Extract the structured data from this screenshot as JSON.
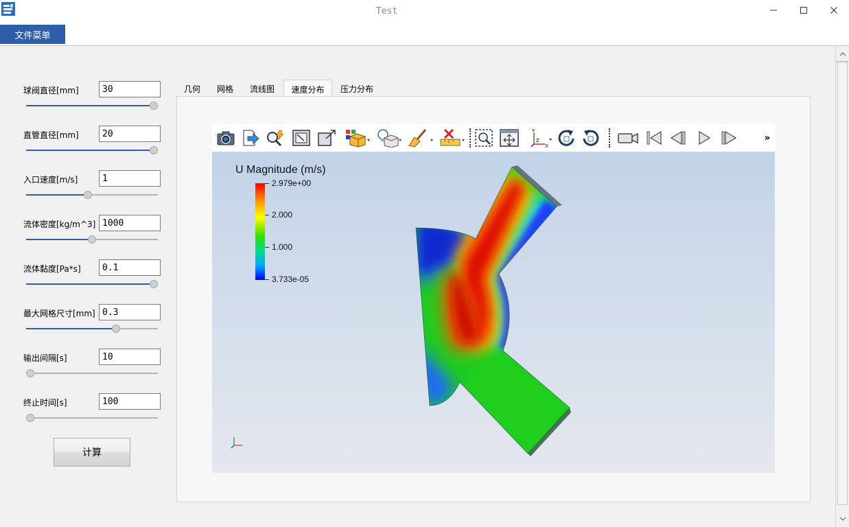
{
  "window": {
    "title": "Test"
  },
  "menu": {
    "file_label": "文件菜单"
  },
  "params": [
    {
      "label": "球阀直径[mm]",
      "value": "30",
      "slider_fraction": 1.0
    },
    {
      "label": "直管直径[mm]",
      "value": "20",
      "slider_fraction": 1.0
    },
    {
      "label": "入口速度[m/s]",
      "value": "1",
      "slider_fraction": 0.47
    },
    {
      "label": "流体密度[kg/m^3]",
      "value": "1000",
      "slider_fraction": 0.5
    },
    {
      "label": "流体黏度[Pa*s]",
      "value": "0.1",
      "slider_fraction": 1.0
    },
    {
      "label": "最大网格尺寸[mm]",
      "value": "0.3",
      "slider_fraction": 0.68
    },
    {
      "label": "输出间隔[s]",
      "value": "10",
      "slider_fraction": 0.0
    },
    {
      "label": "终止时间[s]",
      "value": "100",
      "slider_fraction": 0.0
    }
  ],
  "calc_button": "计算",
  "tabs": [
    {
      "label": "几何",
      "active": false
    },
    {
      "label": "网格",
      "active": false
    },
    {
      "label": "流线图",
      "active": false
    },
    {
      "label": "速度分布",
      "active": true
    },
    {
      "label": "压力分布",
      "active": false
    }
  ],
  "toolbar": {
    "icons": [
      "camera-icon",
      "export-icon",
      "query-icon",
      "reset-view-icon",
      "zoom-to-data-icon",
      "color-blocks-icon",
      "lighting-icon",
      "clean-icon",
      "ruler-icon",
      "zoom-box-icon",
      "fit-view-icon",
      "axes-orient-icon",
      "rotate-cw-icon",
      "rotate-ccw-icon",
      "record-icon",
      "first-frame-icon",
      "prev-frame-icon",
      "play-icon",
      "next-frame-icon"
    ],
    "more": "»"
  },
  "colorbar": {
    "title": "U Magnitude (m/s)",
    "max_label": "2.979e+00",
    "tick_2": "2.000",
    "tick_1": "1.000",
    "min_label": "3.733e-05"
  },
  "axes_triad": {
    "x": "X",
    "y": "Y",
    "z": "Z"
  },
  "colors": {
    "accent": "#2e5ea8"
  }
}
